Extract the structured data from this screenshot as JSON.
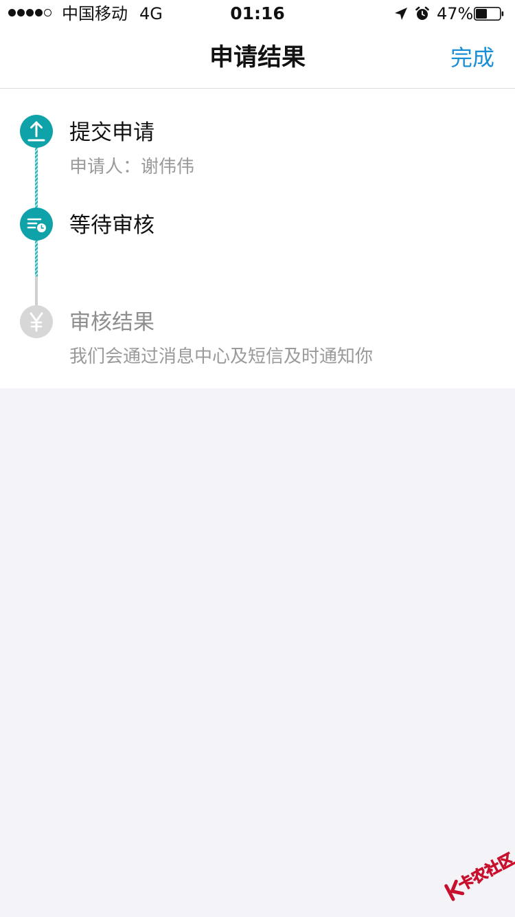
{
  "status_bar": {
    "carrier": "中国移动",
    "network": "4G",
    "time": "01:16",
    "battery_percent": "47%",
    "battery_level": 0.47,
    "signal_bars_filled": 4,
    "signal_bars_total": 5
  },
  "nav": {
    "title": "申请结果",
    "done_label": "完成",
    "done_color": "#1a8fd6"
  },
  "steps": [
    {
      "title": "提交申请",
      "subtitle": "申请人：谢伟伟",
      "state": "completed",
      "icon": "upload-icon"
    },
    {
      "title": "等待审核",
      "subtitle": "",
      "state": "current",
      "icon": "review-list-clock-icon"
    },
    {
      "title": "审核结果",
      "subtitle": "我们会通过消息中心及短信及时通知你",
      "state": "pending",
      "icon": "yen-icon"
    }
  ],
  "colors": {
    "active_step": "#0fa2a9",
    "inactive_step": "#d7d7d7",
    "page_background": "#f4f4f8"
  },
  "watermark": {
    "text": "卡农社区"
  }
}
